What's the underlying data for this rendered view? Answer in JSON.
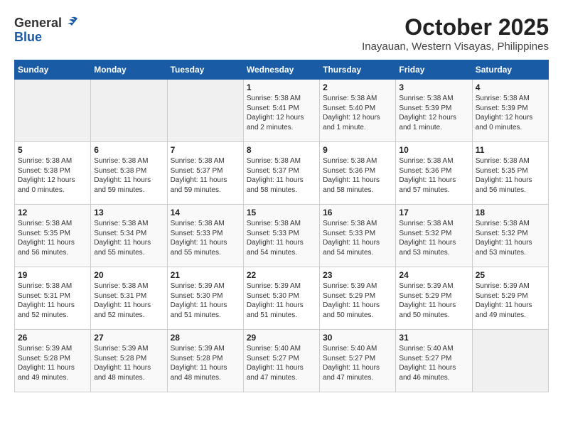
{
  "header": {
    "logo_line1": "General",
    "logo_line2": "Blue",
    "title": "October 2025",
    "subtitle": "Inayauan, Western Visayas, Philippines"
  },
  "weekdays": [
    "Sunday",
    "Monday",
    "Tuesday",
    "Wednesday",
    "Thursday",
    "Friday",
    "Saturday"
  ],
  "weeks": [
    [
      {
        "day": "",
        "info": ""
      },
      {
        "day": "",
        "info": ""
      },
      {
        "day": "",
        "info": ""
      },
      {
        "day": "1",
        "info": "Sunrise: 5:38 AM\nSunset: 5:41 PM\nDaylight: 12 hours\nand 2 minutes."
      },
      {
        "day": "2",
        "info": "Sunrise: 5:38 AM\nSunset: 5:40 PM\nDaylight: 12 hours\nand 1 minute."
      },
      {
        "day": "3",
        "info": "Sunrise: 5:38 AM\nSunset: 5:39 PM\nDaylight: 12 hours\nand 1 minute."
      },
      {
        "day": "4",
        "info": "Sunrise: 5:38 AM\nSunset: 5:39 PM\nDaylight: 12 hours\nand 0 minutes."
      }
    ],
    [
      {
        "day": "5",
        "info": "Sunrise: 5:38 AM\nSunset: 5:38 PM\nDaylight: 12 hours\nand 0 minutes."
      },
      {
        "day": "6",
        "info": "Sunrise: 5:38 AM\nSunset: 5:38 PM\nDaylight: 11 hours\nand 59 minutes."
      },
      {
        "day": "7",
        "info": "Sunrise: 5:38 AM\nSunset: 5:37 PM\nDaylight: 11 hours\nand 59 minutes."
      },
      {
        "day": "8",
        "info": "Sunrise: 5:38 AM\nSunset: 5:37 PM\nDaylight: 11 hours\nand 58 minutes."
      },
      {
        "day": "9",
        "info": "Sunrise: 5:38 AM\nSunset: 5:36 PM\nDaylight: 11 hours\nand 58 minutes."
      },
      {
        "day": "10",
        "info": "Sunrise: 5:38 AM\nSunset: 5:36 PM\nDaylight: 11 hours\nand 57 minutes."
      },
      {
        "day": "11",
        "info": "Sunrise: 5:38 AM\nSunset: 5:35 PM\nDaylight: 11 hours\nand 56 minutes."
      }
    ],
    [
      {
        "day": "12",
        "info": "Sunrise: 5:38 AM\nSunset: 5:35 PM\nDaylight: 11 hours\nand 56 minutes."
      },
      {
        "day": "13",
        "info": "Sunrise: 5:38 AM\nSunset: 5:34 PM\nDaylight: 11 hours\nand 55 minutes."
      },
      {
        "day": "14",
        "info": "Sunrise: 5:38 AM\nSunset: 5:33 PM\nDaylight: 11 hours\nand 55 minutes."
      },
      {
        "day": "15",
        "info": "Sunrise: 5:38 AM\nSunset: 5:33 PM\nDaylight: 11 hours\nand 54 minutes."
      },
      {
        "day": "16",
        "info": "Sunrise: 5:38 AM\nSunset: 5:33 PM\nDaylight: 11 hours\nand 54 minutes."
      },
      {
        "day": "17",
        "info": "Sunrise: 5:38 AM\nSunset: 5:32 PM\nDaylight: 11 hours\nand 53 minutes."
      },
      {
        "day": "18",
        "info": "Sunrise: 5:38 AM\nSunset: 5:32 PM\nDaylight: 11 hours\nand 53 minutes."
      }
    ],
    [
      {
        "day": "19",
        "info": "Sunrise: 5:38 AM\nSunset: 5:31 PM\nDaylight: 11 hours\nand 52 minutes."
      },
      {
        "day": "20",
        "info": "Sunrise: 5:38 AM\nSunset: 5:31 PM\nDaylight: 11 hours\nand 52 minutes."
      },
      {
        "day": "21",
        "info": "Sunrise: 5:39 AM\nSunset: 5:30 PM\nDaylight: 11 hours\nand 51 minutes."
      },
      {
        "day": "22",
        "info": "Sunrise: 5:39 AM\nSunset: 5:30 PM\nDaylight: 11 hours\nand 51 minutes."
      },
      {
        "day": "23",
        "info": "Sunrise: 5:39 AM\nSunset: 5:29 PM\nDaylight: 11 hours\nand 50 minutes."
      },
      {
        "day": "24",
        "info": "Sunrise: 5:39 AM\nSunset: 5:29 PM\nDaylight: 11 hours\nand 50 minutes."
      },
      {
        "day": "25",
        "info": "Sunrise: 5:39 AM\nSunset: 5:29 PM\nDaylight: 11 hours\nand 49 minutes."
      }
    ],
    [
      {
        "day": "26",
        "info": "Sunrise: 5:39 AM\nSunset: 5:28 PM\nDaylight: 11 hours\nand 49 minutes."
      },
      {
        "day": "27",
        "info": "Sunrise: 5:39 AM\nSunset: 5:28 PM\nDaylight: 11 hours\nand 48 minutes."
      },
      {
        "day": "28",
        "info": "Sunrise: 5:39 AM\nSunset: 5:28 PM\nDaylight: 11 hours\nand 48 minutes."
      },
      {
        "day": "29",
        "info": "Sunrise: 5:40 AM\nSunset: 5:27 PM\nDaylight: 11 hours\nand 47 minutes."
      },
      {
        "day": "30",
        "info": "Sunrise: 5:40 AM\nSunset: 5:27 PM\nDaylight: 11 hours\nand 47 minutes."
      },
      {
        "day": "31",
        "info": "Sunrise: 5:40 AM\nSunset: 5:27 PM\nDaylight: 11 hours\nand 46 minutes."
      },
      {
        "day": "",
        "info": ""
      }
    ]
  ]
}
